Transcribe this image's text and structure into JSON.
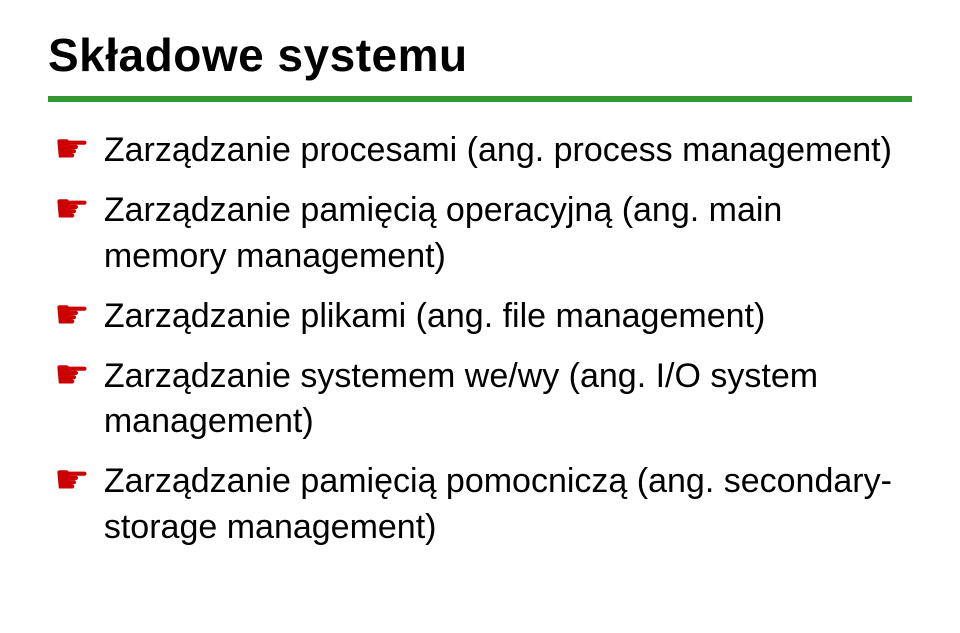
{
  "title": "Składowe systemu",
  "bullets": [
    {
      "text": "Zarządzanie procesami (ang. process management)"
    },
    {
      "text": "Zarządzanie pamięcią operacyjną (ang. main memory management)"
    },
    {
      "text": "Zarządzanie plikami (ang. file management)"
    },
    {
      "text": "Zarządzanie systemem we/wy (ang. I/O system management)"
    },
    {
      "text": "Zarządzanie  pamięcią pomocniczą (ang. secondary-storage management)"
    }
  ]
}
